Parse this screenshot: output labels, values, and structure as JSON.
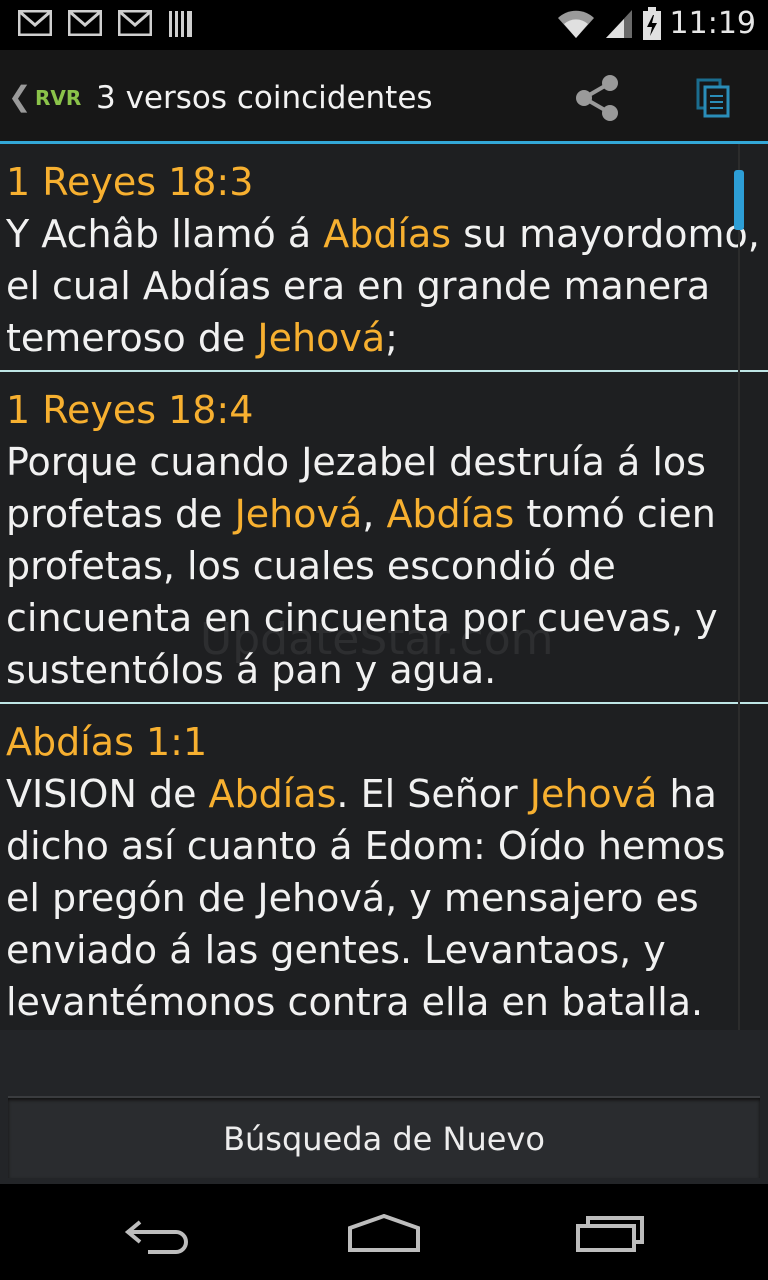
{
  "status_bar": {
    "time": "11:19",
    "icons": [
      "gmail-icon",
      "gmail-icon",
      "gmail-icon",
      "barcode-icon",
      "wifi-icon",
      "signal-icon",
      "battery-icon"
    ]
  },
  "action_bar": {
    "up_glyph": "❮",
    "version": "RVR",
    "title": "3  versos coincidentes",
    "icons": [
      "share-icon",
      "copy-icon"
    ]
  },
  "results": [
    {
      "ref": "1 Reyes 18:3",
      "segments": [
        {
          "t": "Y Achâb llamó á "
        },
        {
          "t": "Abdías",
          "hl": true
        },
        {
          "t": " su mayordomo, el cual Abdías era en grande manera temeroso de "
        },
        {
          "t": "Jehová",
          "hl": true
        },
        {
          "t": ";"
        }
      ]
    },
    {
      "ref": "1 Reyes 18:4",
      "segments": [
        {
          "t": "Porque cuando Jezabel destruía á los profetas de "
        },
        {
          "t": "Jehová",
          "hl": true
        },
        {
          "t": ", "
        },
        {
          "t": "Abdías",
          "hl": true
        },
        {
          "t": " tomó cien profetas, los cuales escondió de cincuenta en cincuenta por cuevas, y sustentólos á pan y agua."
        }
      ]
    },
    {
      "ref": "Abdías 1:1",
      "segments": [
        {
          "t": "VISION de "
        },
        {
          "t": "Abdías",
          "hl": true
        },
        {
          "t": ". El Señor "
        },
        {
          "t": "Jehová",
          "hl": true
        },
        {
          "t": " ha dicho así cuanto á Edom: Oído hemos el pregón de Jehová, y mensajero es enviado á las gentes. Levantaos, y levantémonos contra ella en batalla."
        }
      ]
    }
  ],
  "watermark": "UpdateStar.com",
  "new_search_label": "Búsqueda de Nuevo",
  "nav_icons": [
    "back-icon",
    "home-icon",
    "recent-apps-icon"
  ],
  "colors": {
    "highlight": "#f7b030",
    "accent": "#33a8d8",
    "version": "#8bc34a"
  }
}
